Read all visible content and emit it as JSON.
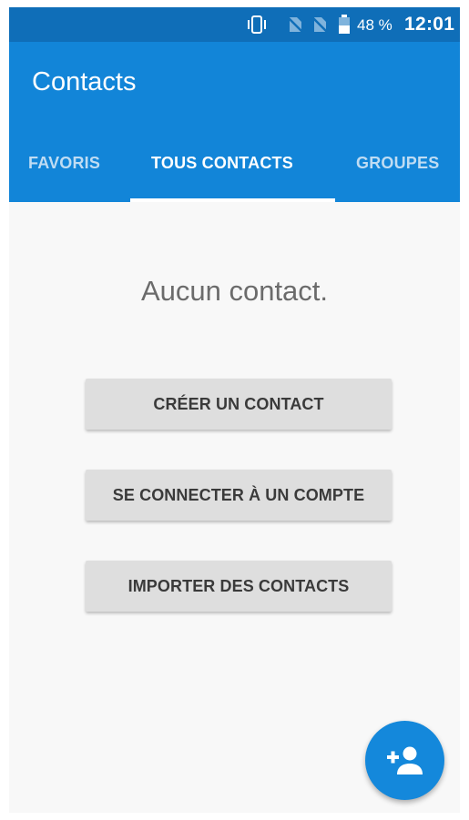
{
  "status_bar": {
    "battery_percent": "48 %",
    "time": "12:01",
    "icons": [
      "vibrate-icon",
      "no-sim-icon",
      "no-sim-icon",
      "battery-icon"
    ]
  },
  "app_bar": {
    "title": "Contacts",
    "tabs": [
      {
        "label": "FAVORIS",
        "selected": false
      },
      {
        "label": "TOUS CONTACTS",
        "selected": true
      },
      {
        "label": "GROUPES",
        "selected": false
      }
    ]
  },
  "main": {
    "empty_message": "Aucun contact.",
    "buttons": [
      {
        "label": "CRÉER UN CONTACT"
      },
      {
        "label": "SE CONNECTER À UN COMPTE"
      },
      {
        "label": "IMPORTER DES CONTACTS"
      }
    ]
  },
  "fab": {
    "icon": "add-person-icon"
  },
  "colors": {
    "status_bar": "#0f6eb8",
    "app_bar": "#1285d8",
    "fab": "#1488db",
    "button_bg": "#dedede",
    "background": "#f8f8f8"
  }
}
